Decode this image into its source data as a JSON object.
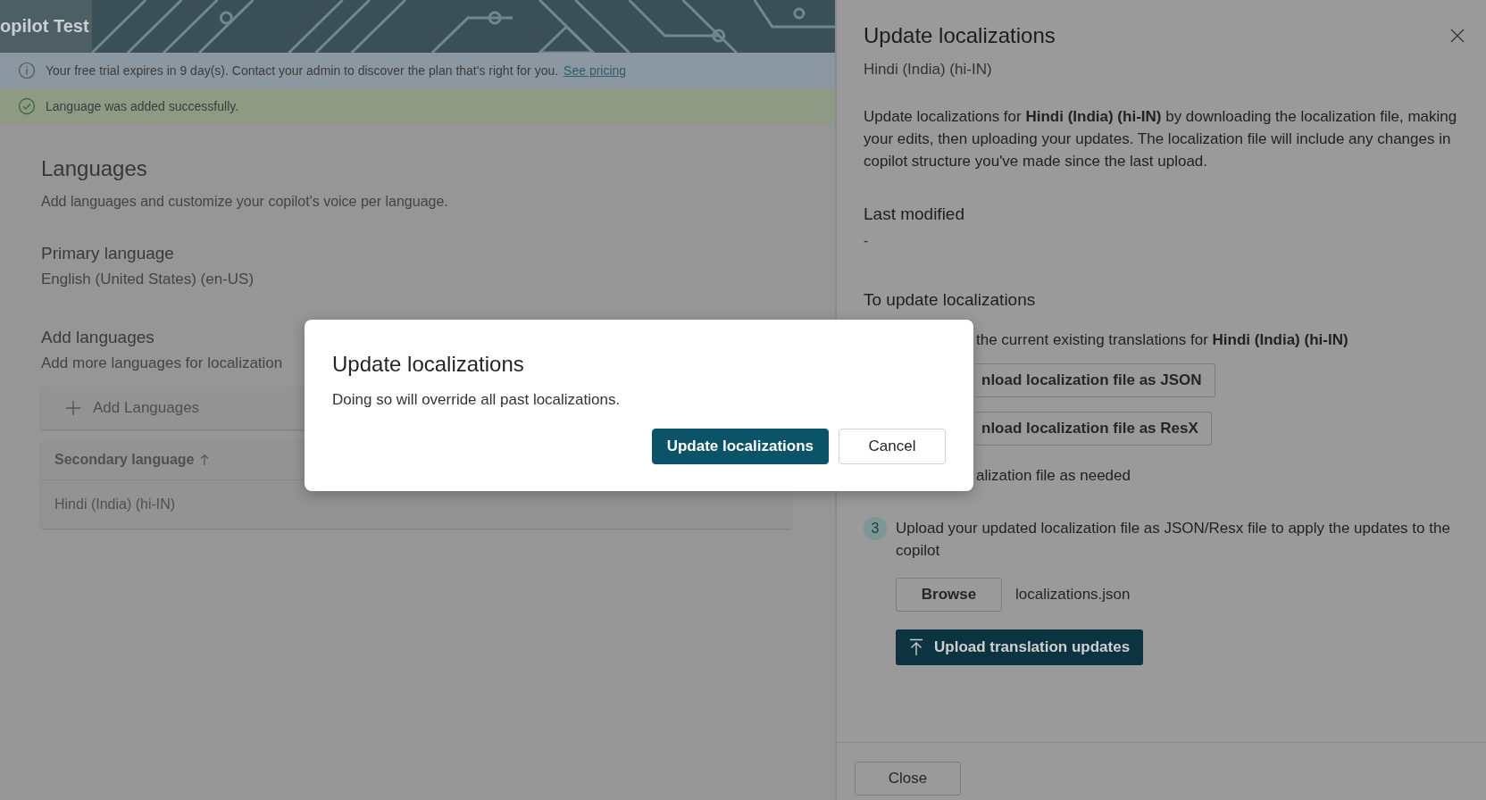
{
  "header": {
    "title": "opilot Test"
  },
  "banners": [
    {
      "kind": "info",
      "text": "Your free trial expires in 9 day(s). Contact your admin to discover the plan that's right for you.",
      "link": "See pricing"
    },
    {
      "kind": "success",
      "text": "Language was added successfully."
    }
  ],
  "page": {
    "title": "Languages",
    "description": "Add languages and customize your copilot's voice per language.",
    "primary": {
      "label": "Primary language",
      "value": "English (United States) (en-US)"
    },
    "add": {
      "label": "Add languages",
      "description": "Add more languages for localization",
      "button": "Add Languages"
    },
    "table": {
      "columns": [
        {
          "label": "Secondary language",
          "sorted_ascending": true
        }
      ],
      "rows": [
        [
          "Hindi (India) (hi-IN)"
        ]
      ]
    }
  },
  "panel": {
    "title": "Update localizations",
    "subtitle": "Hindi (India) (hi-IN)",
    "intro": "Update localizations for **Hindi (India) (hi-IN)** by downloading the localization file, making your edits, then uploading your updates. The localization file will include any changes in copilot structure you've made since the last upload.",
    "last_modified": {
      "label": "Last modified",
      "value": "-"
    },
    "steps_title": "To update localizations",
    "steps": [
      {
        "kind": "partial",
        "text": "the current existing translations for **Hindi (India) (hi-IN)**",
        "buttons": [
          "nload localization file as JSON",
          "nload localization file as ResX"
        ]
      },
      {
        "kind": "partial",
        "text": "alization file as needed"
      },
      {
        "kind": "upload",
        "number": "3",
        "text": "Upload your updated localization file as JSON/Resx file to apply the updates to the copilot",
        "browse": "Browse",
        "file": "localizations.json",
        "upload": "Upload translation updates"
      }
    ],
    "close": "Close"
  },
  "dialog": {
    "title": "Update localizations",
    "text": "Doing so will override all past localizations.",
    "buttons": [
      {
        "label": "Update localizations",
        "primary": true
      },
      {
        "label": "Cancel",
        "primary": false
      }
    ]
  }
}
